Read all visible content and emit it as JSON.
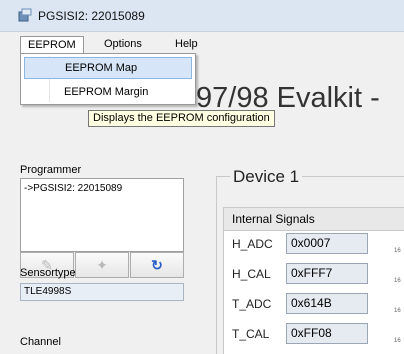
{
  "window": {
    "title": "PGSISI2: 22015089",
    "banner": "97/98 Evalkit -"
  },
  "menubar": {
    "items": [
      "EEPROM",
      "Options",
      "Help"
    ]
  },
  "eeprom_menu": {
    "items": [
      "EEPROM Map",
      "EEPROM Margin"
    ],
    "highlighted_index": 0
  },
  "tooltip": "Displays the EEPROM configuration",
  "programmer": {
    "label": "Programmer",
    "entries": [
      "->PGSISI2: 22015089"
    ]
  },
  "toolbar": {
    "icons": [
      "pencil-icon",
      "pin-icon",
      "refresh-icon"
    ]
  },
  "sensortype": {
    "label": "Sensortype",
    "value": "TLE4998S"
  },
  "channel": {
    "label": "Channel"
  },
  "device": {
    "title": "Device 1",
    "signals_header": "Internal Signals",
    "signals": [
      {
        "name": "H_ADC",
        "value": "0x0007",
        "unit": "16"
      },
      {
        "name": "H_CAL",
        "value": "0xFFF7",
        "unit": "16"
      },
      {
        "name": "T_ADC",
        "value": "0x614B",
        "unit": "16"
      },
      {
        "name": "T_CAL",
        "value": "0xFF08",
        "unit": "16"
      }
    ]
  },
  "colors": {
    "titlebar": "#dce6f3",
    "menu_highlight": "#d6e6f8",
    "tooltip_bg": "#ffffe1",
    "readonly_field": "#e6ebf2",
    "refresh_icon": "#2b5fc7"
  }
}
